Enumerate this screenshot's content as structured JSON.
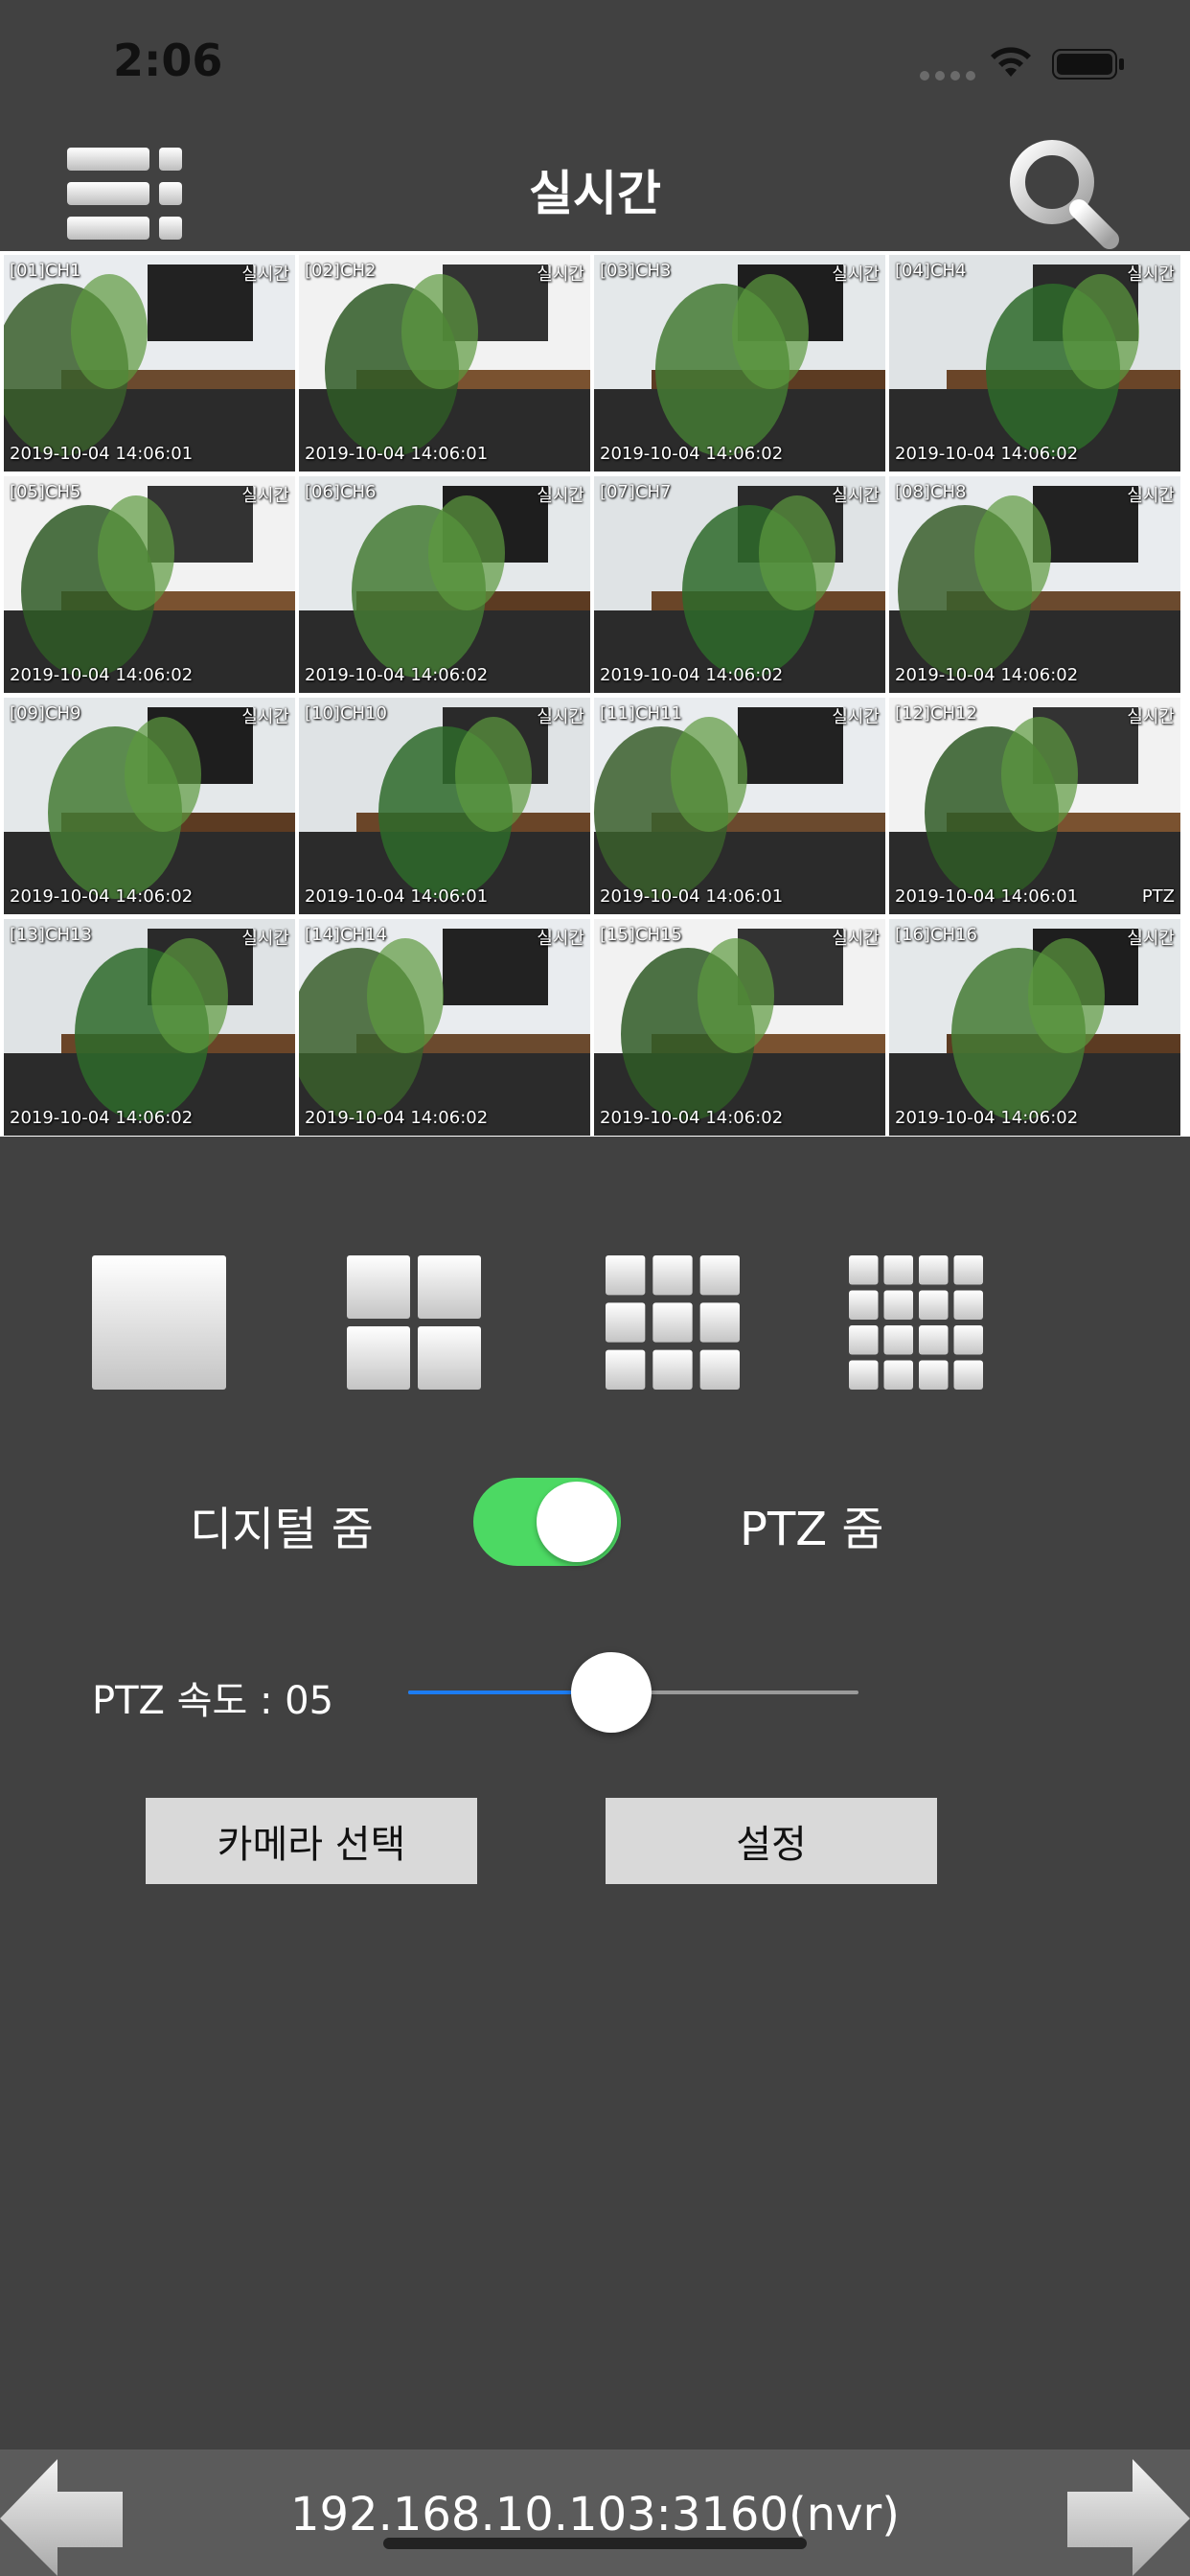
{
  "status": {
    "time": "2:06"
  },
  "nav": {
    "title": "실시간",
    "menu_icon": "menu-list-icon",
    "search_icon": "search-icon"
  },
  "cameras": [
    {
      "label": "[01]CH1",
      "live": "실시간",
      "timestamp": "2019-10-04 14:06:01",
      "ptz": ""
    },
    {
      "label": "[02]CH2",
      "live": "실시간",
      "timestamp": "2019-10-04 14:06:01",
      "ptz": ""
    },
    {
      "label": "[03]CH3",
      "live": "실시간",
      "timestamp": "2019-10-04 14:06:02",
      "ptz": ""
    },
    {
      "label": "[04]CH4",
      "live": "실시간",
      "timestamp": "2019-10-04 14:06:02",
      "ptz": ""
    },
    {
      "label": "[05]CH5",
      "live": "실시간",
      "timestamp": "2019-10-04 14:06:02",
      "ptz": ""
    },
    {
      "label": "[06]CH6",
      "live": "실시간",
      "timestamp": "2019-10-04 14:06:02",
      "ptz": ""
    },
    {
      "label": "[07]CH7",
      "live": "실시간",
      "timestamp": "2019-10-04 14:06:02",
      "ptz": ""
    },
    {
      "label": "[08]CH8",
      "live": "실시간",
      "timestamp": "2019-10-04 14:06:02",
      "ptz": ""
    },
    {
      "label": "[09]CH9",
      "live": "실시간",
      "timestamp": "2019-10-04 14:06:02",
      "ptz": ""
    },
    {
      "label": "[10]CH10",
      "live": "실시간",
      "timestamp": "2019-10-04 14:06:01",
      "ptz": ""
    },
    {
      "label": "[11]CH11",
      "live": "실시간",
      "timestamp": "2019-10-04 14:06:01",
      "ptz": ""
    },
    {
      "label": "[12]CH12",
      "live": "실시간",
      "timestamp": "2019-10-04 14:06:01",
      "ptz": "PTZ"
    },
    {
      "label": "[13]CH13",
      "live": "실시간",
      "timestamp": "2019-10-04 14:06:02",
      "ptz": ""
    },
    {
      "label": "[14]CH14",
      "live": "실시간",
      "timestamp": "2019-10-04 14:06:02",
      "ptz": ""
    },
    {
      "label": "[15]CH15",
      "live": "실시간",
      "timestamp": "2019-10-04 14:06:02",
      "ptz": ""
    },
    {
      "label": "[16]CH16",
      "live": "실시간",
      "timestamp": "2019-10-04 14:06:02",
      "ptz": ""
    }
  ],
  "layouts": [
    {
      "name": "layout-1x1-icon",
      "divisions": 1
    },
    {
      "name": "layout-2x2-icon",
      "divisions": 2
    },
    {
      "name": "layout-3x3-icon",
      "divisions": 3
    },
    {
      "name": "layout-4x4-icon",
      "divisions": 4
    }
  ],
  "zoom": {
    "digital_label": "디지털 줌",
    "ptz_label": "PTZ 줌",
    "toggle_on": true,
    "toggle_color": "#4cd963"
  },
  "ptz_speed": {
    "label": "PTZ 속도 : 05",
    "value_fraction": 0.45,
    "fill_color": "#1c7cf2"
  },
  "buttons": {
    "camera_select": "카메라 선택",
    "settings": "설정"
  },
  "footer": {
    "address": "192.168.10.103:3160(nvr)",
    "prev_icon": "arrow-left-icon",
    "next_icon": "arrow-right-icon"
  }
}
